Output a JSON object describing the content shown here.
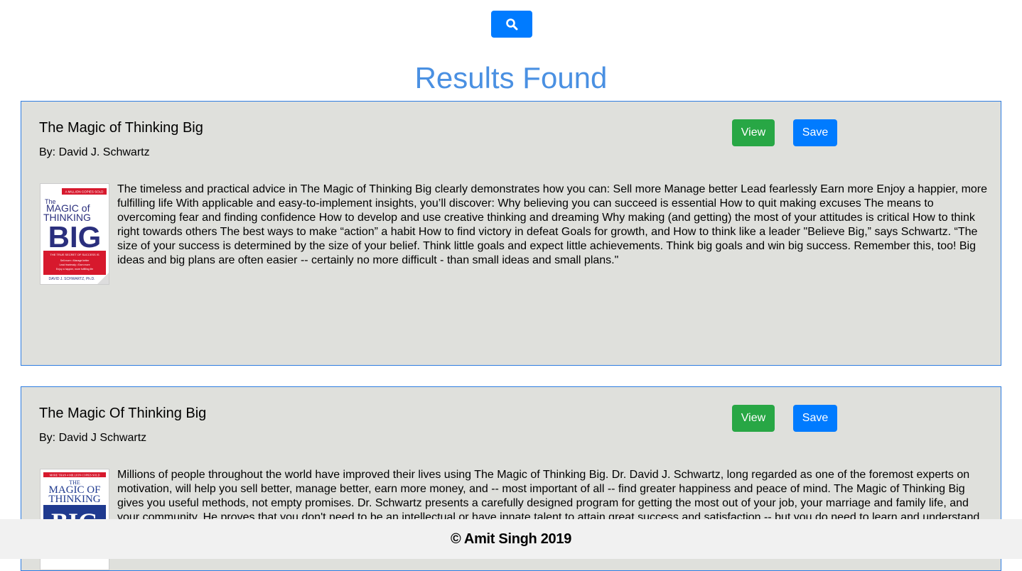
{
  "search": {
    "icon": "search-icon"
  },
  "page": {
    "title": "Results Found"
  },
  "results": [
    {
      "title": "The Magic of Thinking Big",
      "author": "By: David J. Schwartz",
      "view_label": "View",
      "save_label": "Save",
      "cover": {
        "badge": "A MILLION COPIES SOLD",
        "line1": "The",
        "line2": "MAGIC of",
        "line3": "THINKING",
        "line4": "BIG",
        "tagline": "THE TRUE SECRET OF SUCCESS IS",
        "points": "Sell more • Manage better\nLead fearlessly • Earn more\nEnjoy a happier, more fulfilling life",
        "author": "DAVID J. SCHWARTZ, Ph.D."
      },
      "description": "The timeless and practical advice in The Magic of Thinking Big clearly demonstrates how you can: Sell more Manage better Lead fearlessly Earn more Enjoy a happier, more fulfilling life With applicable and easy-to-implement insights, you’ll discover: Why believing you can succeed is essential How to quit making excuses The means to overcoming fear and finding confidence How to develop and use creative thinking and dreaming Why making (and getting) the most of your attitudes is critical How to think right towards others The best ways to make “action” a habit How to find victory in defeat Goals for growth, and How to think like a leader \"Believe Big,” says Schwartz. “The size of your success is determined by the size of your belief. Think little goals and expect little achievements. Think big goals and win big success. Remember this, too! Big ideas and big plans are often easier -- certainly no more difficult - than small ideas and small plans.\""
    },
    {
      "title": "The Magic Of Thinking Big",
      "author": "By: David J Schwartz",
      "view_label": "View",
      "save_label": "Save",
      "cover": {
        "badge": "MORE THAN 4 MILLION COPIES SOLD",
        "line1": "THE",
        "line2": "MAGIC OF",
        "line3": "THINKING",
        "line4": "BIG"
      },
      "description": "Millions of people throughout the world have improved their lives using The Magic of Thinking Big. Dr. David J. Schwartz, long regarded as one of the foremost experts on motivation, will help you sell better, manage better, earn more money, and -- most important of all -- find greater happiness and peace of mind. The Magic of Thinking Big gives you useful methods, not empty promises. Dr. Schwartz presents a carefully designed program for getting the most out of your job, your marriage and family life, and your community. He proves that you don't need to be an intellectual or have innate talent to attain great success and satisfaction -- but you do need to learn and understand"
    }
  ],
  "footer": {
    "text": "© Amit Singh 2019"
  },
  "colors": {
    "primary": "#007bff",
    "success": "#28a745",
    "title": "#4a90e2",
    "card_bg": "#dfe0dc",
    "card_border": "#2f7de1",
    "footer_bg": "#f1f1f1"
  }
}
